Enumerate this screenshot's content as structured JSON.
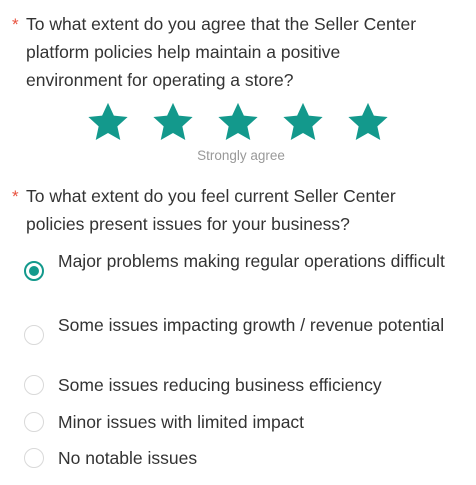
{
  "accent_color": "#13998c",
  "required_color": "#e8523f",
  "question1": {
    "required_mark": "*",
    "text": "To what extent do you agree that the Seller Center platform policies help maintain a positive environment for operating a store?",
    "rating": {
      "value": 5,
      "max": 5,
      "caption": "Strongly agree"
    }
  },
  "question2": {
    "required_mark": "*",
    "text": "To what extent do you feel current Seller Center policies present issues for your business?",
    "options": [
      {
        "label": "Major problems making regular operations difficult",
        "selected": true
      },
      {
        "label": "Some issues impacting growth / revenue potential",
        "selected": false
      },
      {
        "label": "Some issues reducing business efficiency",
        "selected": false
      },
      {
        "label": "Minor issues with limited impact",
        "selected": false
      },
      {
        "label": "No notable issues",
        "selected": false
      }
    ]
  }
}
